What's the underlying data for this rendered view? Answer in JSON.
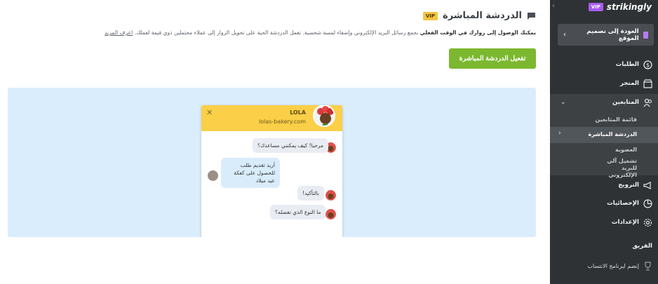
{
  "main": {
    "title": "الدردشة المباشرة",
    "vip_badge": "VIP",
    "description_bold": "يمكنك الوصول إلى زوارك في الوقت الفعلي",
    "description_text": " بجمع رسائل البريد الإلكتروني وإضفاء لمسة شخصية. تعمل الدردشة الحية على تحويل الزوار إلى عملاء محتملين ذوي قيمة لعملك. ",
    "learn_more": "اعرف المزيد",
    "activate_button": "تفعيل الدردشة المباشرة"
  },
  "widget": {
    "name": "LOLA",
    "site": "lolas-bakery.com",
    "messages": [
      {
        "from": "bot",
        "text": "مرحبا! كيف يمكنني مساعدك؟"
      },
      {
        "from": "customer",
        "text": "أريد تقديم طلب للحصول على كعكة عيد ميلاد"
      },
      {
        "from": "bot",
        "text": "بالتأكيد!"
      },
      {
        "from": "bot",
        "text": "ما النوع الذي تفضله؟"
      }
    ]
  },
  "sidebar": {
    "brand": "strikingly",
    "vip_badge": "VIP",
    "back_button": "العودة إلى تصميم الموقع",
    "items": {
      "orders": "الطلبات",
      "store": "المتجر",
      "followers": "المتابعين",
      "followers_list": "قائمة المتابعين",
      "live_chat": "الدردشة المباشرة",
      "membership": "العضوية",
      "email_automation": "تشغيل آلي للبريد الإلكتروني",
      "promotion": "الترويج",
      "analytics": "الإحصائيات",
      "settings": "الإعدادات",
      "team": "الفريق",
      "affiliate": "إنضم لبرنامج الانتساب"
    }
  },
  "colors": {
    "sidebar_bg": "#2f3234",
    "accent_green": "#7cb82f",
    "vip_yellow": "#f6c343",
    "vip_purple": "#a65cf0",
    "preview_bg": "#daedfc",
    "widget_header": "#fbcf47"
  },
  "icons": [
    "chat-bubble-icon",
    "dollar-circle-icon",
    "store-icon",
    "followers-icon",
    "megaphone-icon",
    "pie-chart-icon",
    "gear-icon",
    "trophy-icon",
    "close-icon",
    "chevron-left-icon",
    "chevron-down-icon"
  ]
}
